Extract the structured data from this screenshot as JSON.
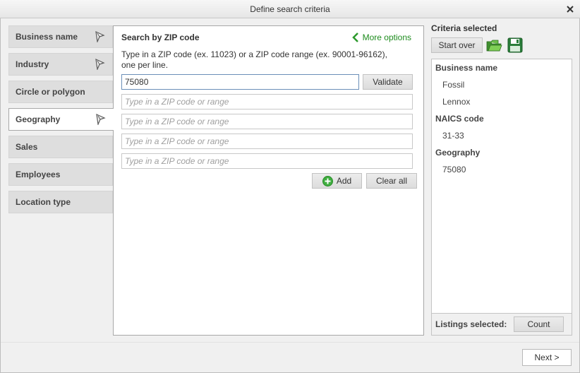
{
  "window": {
    "title": "Define search criteria",
    "close_glyph": "✕"
  },
  "nav": {
    "items": [
      {
        "label": "Business name",
        "has_flag": true
      },
      {
        "label": "Industry",
        "has_flag": true
      },
      {
        "label": "Circle or polygon",
        "has_flag": false
      },
      {
        "label": "Geography",
        "has_flag": true,
        "active": true
      },
      {
        "label": "Sales",
        "has_flag": false
      },
      {
        "label": "Employees",
        "has_flag": false
      },
      {
        "label": "Location type",
        "has_flag": false
      }
    ],
    "flag_icon": "pin-flag-icon"
  },
  "zip": {
    "title": "Search by ZIP code",
    "more_options": "More options",
    "instructions": "Type in a ZIP code (ex. 11023) or a ZIP code range (ex. 90001-96162), one per line.",
    "inputs": [
      {
        "value": "75080",
        "placeholder": "Type in a ZIP code or range"
      },
      {
        "value": "",
        "placeholder": "Type in a ZIP code or range"
      },
      {
        "value": "",
        "placeholder": "Type in a ZIP code or range"
      },
      {
        "value": "",
        "placeholder": "Type in a ZIP code or range"
      },
      {
        "value": "",
        "placeholder": "Type in a ZIP code or range"
      }
    ],
    "validate_label": "Validate",
    "add_label": "Add",
    "clear_label": "Clear all"
  },
  "criteria": {
    "title": "Criteria selected",
    "start_over_label": "Start over",
    "groups": [
      {
        "heading": "Business name",
        "values": [
          "Fossil",
          "Lennox"
        ]
      },
      {
        "heading": "NAICS code",
        "values": [
          "31-33"
        ]
      },
      {
        "heading": "Geography",
        "values": [
          "75080"
        ]
      }
    ],
    "listings_label": "Listings selected:",
    "count_label": "Count"
  },
  "footer": {
    "next_label": "Next >"
  },
  "colors": {
    "accent_green": "#1e8c1e",
    "active_border": "#6b8fb8"
  }
}
